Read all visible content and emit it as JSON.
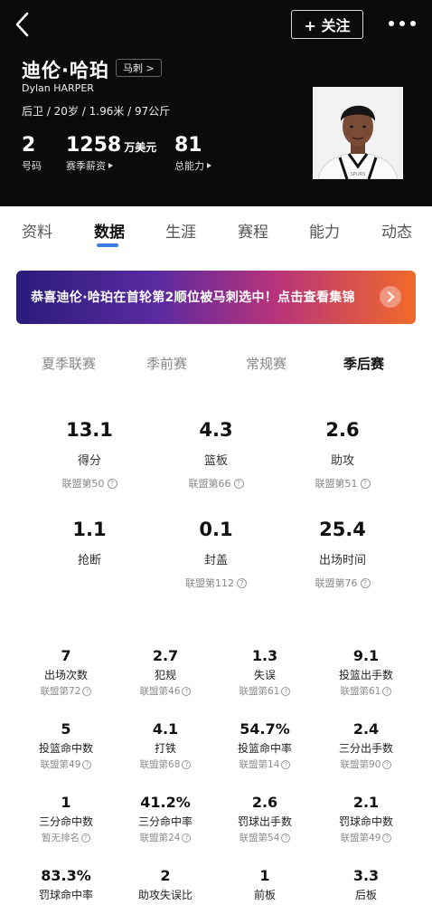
{
  "header": {
    "name_cn": "迪伦·哈珀",
    "team_badge": "马刺 >",
    "name_en": "Dylan HARPER",
    "meta": "后卫 / 20岁 / 1.96米 / 97公斤",
    "follow_label": "+ 关注",
    "kpis": [
      {
        "value": "2",
        "unit": "",
        "label": "号码",
        "arrow": false
      },
      {
        "value": "1258",
        "unit": "万美元",
        "label": "赛季薪资",
        "arrow": true
      },
      {
        "value": "81",
        "unit": "",
        "label": "总能力",
        "arrow": true
      }
    ]
  },
  "tabs": [
    "资料",
    "数据",
    "生涯",
    "赛程",
    "能力",
    "动态"
  ],
  "active_tab": "数据",
  "banner": {
    "text": "恭喜迪伦·哈珀在首轮第2顺位被马刺选中！点击查看集锦"
  },
  "season_tabs": [
    "夏季联赛",
    "季前赛",
    "常规赛",
    "季后赛"
  ],
  "active_season_tab": "季后赛",
  "big_stats": [
    {
      "value": "13.1",
      "name": "得分",
      "rank": "联盟第50"
    },
    {
      "value": "4.3",
      "name": "篮板",
      "rank": "联盟第66"
    },
    {
      "value": "2.6",
      "name": "助攻",
      "rank": "联盟第51"
    },
    {
      "value": "1.1",
      "name": "抢断",
      "rank": ""
    },
    {
      "value": "0.1",
      "name": "封盖",
      "rank": "联盟第112"
    },
    {
      "value": "25.4",
      "name": "出场时间",
      "rank": "联盟第76"
    }
  ],
  "small_stats": [
    {
      "value": "7",
      "name": "出场次数",
      "rank": "联盟第72"
    },
    {
      "value": "2.7",
      "name": "犯规",
      "rank": "联盟第46"
    },
    {
      "value": "1.3",
      "name": "失误",
      "rank": "联盟第61"
    },
    {
      "value": "9.1",
      "name": "投篮出手数",
      "rank": "联盟第61"
    },
    {
      "value": "5",
      "name": "投篮命中数",
      "rank": "联盟第49"
    },
    {
      "value": "4.1",
      "name": "打铁",
      "rank": "联盟第68"
    },
    {
      "value": "54.7%",
      "name": "投篮命中率",
      "rank": "联盟第14"
    },
    {
      "value": "2.4",
      "name": "三分出手数",
      "rank": "联盟第90"
    },
    {
      "value": "1",
      "name": "三分命中数",
      "rank": "暂无排名"
    },
    {
      "value": "41.2%",
      "name": "三分命中率",
      "rank": "联盟第24"
    },
    {
      "value": "2.6",
      "name": "罚球出手数",
      "rank": "联盟第54"
    },
    {
      "value": "2.1",
      "name": "罚球命中数",
      "rank": "联盟第49"
    },
    {
      "value": "83.3%",
      "name": "罚球命中率",
      "rank": ""
    },
    {
      "value": "2",
      "name": "助攻失误比",
      "rank": ""
    },
    {
      "value": "1",
      "name": "前板",
      "rank": ""
    },
    {
      "value": "3.3",
      "name": "后板",
      "rank": ""
    }
  ],
  "colors": {
    "header_bg": "#0b0b0b",
    "accent": "#3a7be0"
  }
}
